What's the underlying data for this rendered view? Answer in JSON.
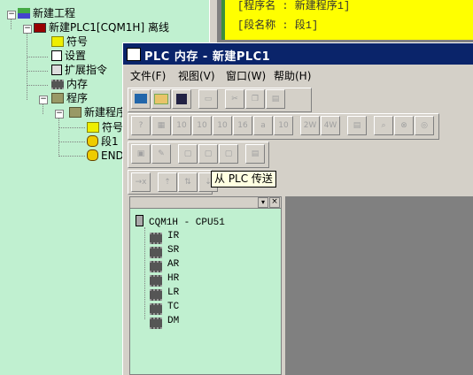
{
  "project_tree": {
    "root": "新建工程",
    "plc": "新建PLC1[CQM1H] 离线",
    "items": [
      "符号",
      "设置",
      "扩展指令",
      "内存",
      "程序"
    ],
    "program": "新建程序",
    "program_children": [
      "符号",
      "段1",
      "END"
    ]
  },
  "editor": {
    "program_name_line": "[程序名 : 新建程序1]",
    "section_name_line": "[段名称 : 段1]"
  },
  "window": {
    "title": "PLC 内存 - 新建PLC1",
    "menu": [
      "文件(F)",
      "视图(V)",
      "窗口(W)",
      "帮助(H)"
    ]
  },
  "toolbar": {
    "row2_labels": [
      "?",
      "",
      "10",
      "10",
      "10",
      "16",
      "a",
      "10",
      "2W",
      "4W",
      "",
      "",
      "",
      ""
    ],
    "tooltip": "从 PLC 传送"
  },
  "memory_tree": {
    "root": "CQM1H - CPU51",
    "areas": [
      "IR",
      "SR",
      "AR",
      "HR",
      "LR",
      "TC",
      "DM"
    ]
  }
}
